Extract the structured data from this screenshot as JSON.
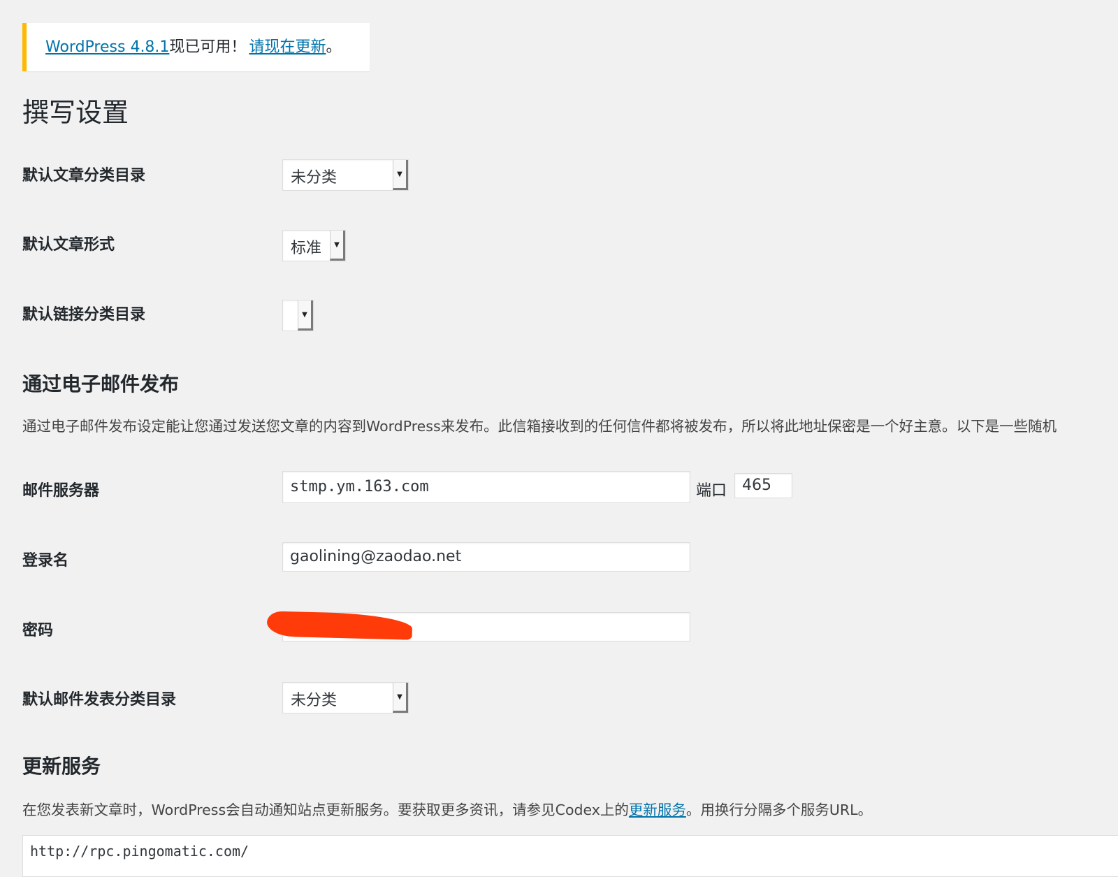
{
  "notice": {
    "version_link": "WordPress 4.8.1",
    "available_text": "现已可用！",
    "update_link": "请现在更新",
    "period": "。"
  },
  "page": {
    "title": "撰写设置"
  },
  "writing": {
    "default_category": {
      "label": "默认文章分类目录",
      "selected": "未分类"
    },
    "default_format": {
      "label": "默认文章形式",
      "selected": "标准"
    },
    "default_link_category": {
      "label": "默认链接分类目录",
      "selected": ""
    }
  },
  "email_post": {
    "section_title": "通过电子邮件发布",
    "description": "通过电子邮件发布设定能让您通过发送您文章的内容到WordPress来发布。此信箱接收到的任何信件都将被发布，所以将此地址保密是一个好主意。以下是一些随机",
    "mail_server": {
      "label": "邮件服务器",
      "value": "stmp.ym.163.com"
    },
    "port": {
      "label": "端口",
      "value": "465"
    },
    "login": {
      "label": "登录名",
      "value": "gaolining@zaodao.net"
    },
    "password": {
      "label": "密码",
      "value": ""
    },
    "default_mail_category": {
      "label": "默认邮件发表分类目录",
      "selected": "未分类"
    }
  },
  "update_services": {
    "section_title": "更新服务",
    "desc_before": "在您发表新文章时，WordPress会自动通知站点更新服务。要获取更多资讯，请参见Codex上的",
    "desc_link": "更新服务",
    "desc_after": "。用换行分隔多个服务URL。",
    "ping_urls": "http://rpc.pingomatic.com/"
  },
  "colors": {
    "notice_border": "#ffb900",
    "link": "#0073aa",
    "redaction": "#ff3b0a"
  }
}
